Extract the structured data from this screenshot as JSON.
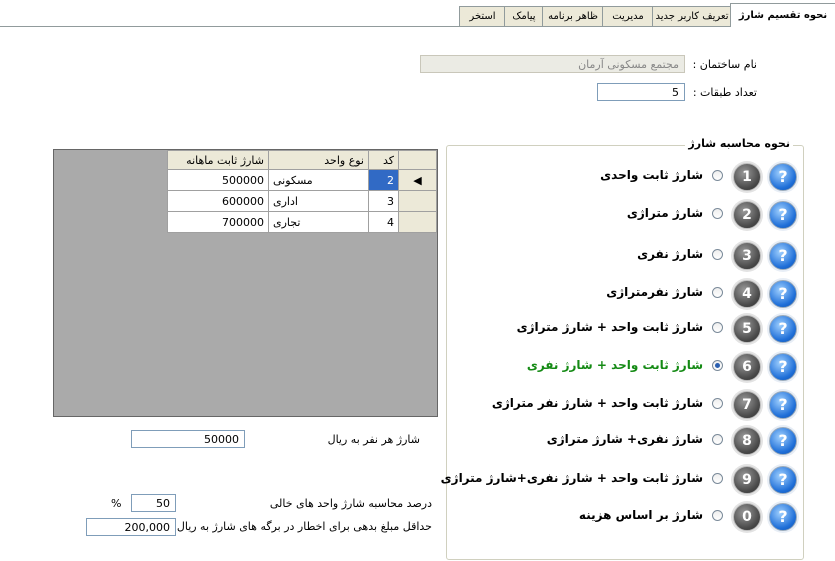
{
  "tabs": [
    {
      "label": "نحوه تقسیم شارژ",
      "active": true
    },
    {
      "label": "تعریف کاربر جدید",
      "active": false
    },
    {
      "label": "مدیریت",
      "active": false
    },
    {
      "label": "ظاهر برنامه",
      "active": false
    },
    {
      "label": "پیامک",
      "active": false
    },
    {
      "label": "استخر",
      "active": false
    }
  ],
  "building": {
    "name_label": "نام ساختمان :",
    "name_value": "مجتمع مسکونی آرمان",
    "floors_label": "تعداد طبقات :",
    "floors_value": "5"
  },
  "charge_method": {
    "title": "نحوه محاسبه شارژ",
    "selected_index": 5,
    "options": [
      {
        "number": "1",
        "label": "شارژ ثابت واحدی"
      },
      {
        "number": "2",
        "label": "شارژ متراژی"
      },
      {
        "number": "3",
        "label": "شارژ نفری"
      },
      {
        "number": "4",
        "label": "شارژ نفرمتراژی"
      },
      {
        "number": "5",
        "label": "شارژ ثابت واحد + شارژ متراژی"
      },
      {
        "number": "6",
        "label": "شارژ ثابت واحد + شارژ نفری"
      },
      {
        "number": "7",
        "label": "شارژ ثابت واحد + شارژ نفر متراژی"
      },
      {
        "number": "8",
        "label": "شارژ نفری+ شارژ متراژی"
      },
      {
        "number": "9",
        "label": "شارژ ثابت واحد + شارژ نفری+شارژ متراژی"
      },
      {
        "number": "0",
        "label": "شارژ بر اساس هزینه"
      }
    ]
  },
  "unit_grid": {
    "headers": {
      "code": "کد",
      "type": "نوع واحد",
      "charge": "شارژ ثابت ماهانه"
    },
    "current_row_marker": "◀",
    "rows": [
      {
        "code": "2",
        "type": "مسکونی",
        "charge": "500000",
        "selected": true
      },
      {
        "code": "3",
        "type": "اداری",
        "charge": "600000",
        "selected": false
      },
      {
        "code": "4",
        "type": "تجاری",
        "charge": "700000",
        "selected": false
      }
    ]
  },
  "per_person": {
    "label": "شارژ هر نفر به ریال",
    "value": "50000"
  },
  "vacant": {
    "label": "درصد محاسبه شارژ واحد های خالی",
    "value": "50",
    "unit": "%"
  },
  "min_debt": {
    "label": "حداقل مبلغ بدهی برای اخطار در برگه های شارژ به ریال",
    "value": "200,000"
  }
}
